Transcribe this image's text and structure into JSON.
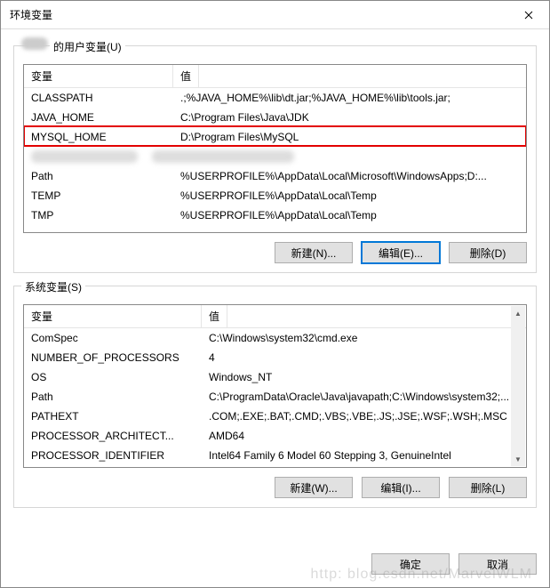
{
  "dialog": {
    "title": "环境变量",
    "close_label": "×"
  },
  "user_vars": {
    "group_label_suffix": "的用户变量(U)",
    "col_name": "变量",
    "col_value": "值",
    "rows": [
      {
        "name": "CLASSPATH",
        "value": ".;%JAVA_HOME%\\lib\\dt.jar;%JAVA_HOME%\\lib\\tools.jar;"
      },
      {
        "name": "JAVA_HOME",
        "value": "C:\\Program Files\\Java\\JDK"
      },
      {
        "name": "MYSQL_HOME",
        "value": "D:\\Program Files\\MySQL"
      },
      {
        "name": "",
        "value": ""
      },
      {
        "name": "Path",
        "value": "%USERPROFILE%\\AppData\\Local\\Microsoft\\WindowsApps;D:..."
      },
      {
        "name": "TEMP",
        "value": "%USERPROFILE%\\AppData\\Local\\Temp"
      },
      {
        "name": "TMP",
        "value": "%USERPROFILE%\\AppData\\Local\\Temp"
      }
    ],
    "btn_new": "新建(N)...",
    "btn_edit": "编辑(E)...",
    "btn_delete": "删除(D)"
  },
  "system_vars": {
    "group_label": "系统变量(S)",
    "col_name": "变量",
    "col_value": "值",
    "rows": [
      {
        "name": "ComSpec",
        "value": "C:\\Windows\\system32\\cmd.exe"
      },
      {
        "name": "NUMBER_OF_PROCESSORS",
        "value": "4"
      },
      {
        "name": "OS",
        "value": "Windows_NT"
      },
      {
        "name": "Path",
        "value": "C:\\ProgramData\\Oracle\\Java\\javapath;C:\\Windows\\system32;..."
      },
      {
        "name": "PATHEXT",
        "value": ".COM;.EXE;.BAT;.CMD;.VBS;.VBE;.JS;.JSE;.WSF;.WSH;.MSC"
      },
      {
        "name": "PROCESSOR_ARCHITECT...",
        "value": "AMD64"
      },
      {
        "name": "PROCESSOR_IDENTIFIER",
        "value": "Intel64 Family 6 Model 60 Stepping 3, GenuineIntel"
      }
    ],
    "btn_new": "新建(W)...",
    "btn_edit": "编辑(I)...",
    "btn_delete": "删除(L)"
  },
  "footer": {
    "ok": "确定",
    "cancel": "取消"
  },
  "watermark": "http: blog.csdn.net/MarvelWLM"
}
